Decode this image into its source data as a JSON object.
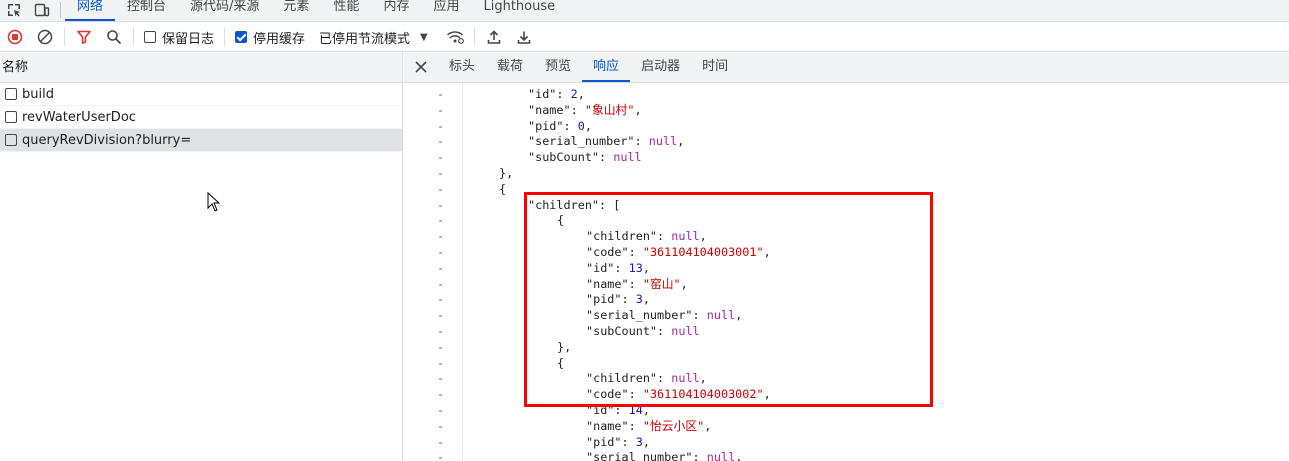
{
  "devtools_tabs": [
    "网络",
    "控制台",
    "源代码/来源",
    "元素",
    "性能",
    "内存",
    "应用",
    "Lighthouse"
  ],
  "active_tab_index": 0,
  "toolbar": {
    "preserve_log": "保留日志",
    "disable_cache": "停用缓存",
    "throttle": "已停用节流模式"
  },
  "left": {
    "header": "名称",
    "requests": [
      "build",
      "revWaterUserDoc",
      "queryRevDivision?blurry="
    ],
    "selected_index": 2
  },
  "detail_tabs": [
    "标头",
    "载荷",
    "预览",
    "响应",
    "启动器",
    "时间"
  ],
  "active_detail_index": 3,
  "code_lines": [
    {
      "indent": 0,
      "parts": [
        [
          "k",
          "\"id\""
        ],
        [
          "p",
          ": "
        ],
        [
          "n",
          "2"
        ],
        [
          "p",
          ","
        ]
      ]
    },
    {
      "indent": 0,
      "parts": [
        [
          "k",
          "\"name\""
        ],
        [
          "p",
          ": "
        ],
        [
          "s",
          "\"象山村\""
        ],
        [
          "p",
          ","
        ]
      ]
    },
    {
      "indent": 0,
      "parts": [
        [
          "k",
          "\"pid\""
        ],
        [
          "p",
          ": "
        ],
        [
          "n",
          "0"
        ],
        [
          "p",
          ","
        ]
      ]
    },
    {
      "indent": 0,
      "parts": [
        [
          "k",
          "\"serial_number\""
        ],
        [
          "p",
          ": "
        ],
        [
          "w",
          "null"
        ],
        [
          "p",
          ","
        ]
      ]
    },
    {
      "indent": 0,
      "parts": [
        [
          "k",
          "\"subCount\""
        ],
        [
          "p",
          ": "
        ],
        [
          "w",
          "null"
        ]
      ]
    },
    {
      "indent": -1,
      "parts": [
        [
          "p",
          "},"
        ]
      ]
    },
    {
      "indent": -1,
      "parts": [
        [
          "p",
          "{"
        ]
      ]
    },
    {
      "indent": 0,
      "parts": [
        [
          "k",
          "\"children\""
        ],
        [
          "p",
          ": ["
        ]
      ]
    },
    {
      "indent": 1,
      "parts": [
        [
          "p",
          "{"
        ]
      ]
    },
    {
      "indent": 2,
      "parts": [
        [
          "k",
          "\"children\""
        ],
        [
          "p",
          ": "
        ],
        [
          "w",
          "null"
        ],
        [
          "p",
          ","
        ]
      ]
    },
    {
      "indent": 2,
      "parts": [
        [
          "k",
          "\"code\""
        ],
        [
          "p",
          ": "
        ],
        [
          "s",
          "\"361104104003001\""
        ],
        [
          "p",
          ","
        ]
      ]
    },
    {
      "indent": 2,
      "parts": [
        [
          "k",
          "\"id\""
        ],
        [
          "p",
          ": "
        ],
        [
          "n",
          "13"
        ],
        [
          "p",
          ","
        ]
      ]
    },
    {
      "indent": 2,
      "parts": [
        [
          "k",
          "\"name\""
        ],
        [
          "p",
          ": "
        ],
        [
          "s",
          "\"窑山\""
        ],
        [
          "p",
          ","
        ]
      ]
    },
    {
      "indent": 2,
      "parts": [
        [
          "k",
          "\"pid\""
        ],
        [
          "p",
          ": "
        ],
        [
          "n",
          "3"
        ],
        [
          "p",
          ","
        ]
      ]
    },
    {
      "indent": 2,
      "parts": [
        [
          "k",
          "\"serial_number\""
        ],
        [
          "p",
          ": "
        ],
        [
          "w",
          "null"
        ],
        [
          "p",
          ","
        ]
      ]
    },
    {
      "indent": 2,
      "parts": [
        [
          "k",
          "\"subCount\""
        ],
        [
          "p",
          ": "
        ],
        [
          "w",
          "null"
        ]
      ]
    },
    {
      "indent": 1,
      "parts": [
        [
          "p",
          "},"
        ]
      ]
    },
    {
      "indent": 1,
      "parts": [
        [
          "p",
          "{"
        ]
      ]
    },
    {
      "indent": 2,
      "parts": [
        [
          "k",
          "\"children\""
        ],
        [
          "p",
          ": "
        ],
        [
          "w",
          "null"
        ],
        [
          "p",
          ","
        ]
      ]
    },
    {
      "indent": 2,
      "parts": [
        [
          "k",
          "\"code\""
        ],
        [
          "p",
          ": "
        ],
        [
          "s",
          "\"361104104003002\""
        ],
        [
          "p",
          ","
        ]
      ]
    },
    {
      "indent": 2,
      "parts": [
        [
          "k",
          "\"id\""
        ],
        [
          "p",
          ": "
        ],
        [
          "n",
          "14"
        ],
        [
          "p",
          ","
        ]
      ]
    },
    {
      "indent": 2,
      "parts": [
        [
          "k",
          "\"name\""
        ],
        [
          "p",
          ": "
        ],
        [
          "s",
          "\"怡云小区\""
        ],
        [
          "p",
          ","
        ]
      ]
    },
    {
      "indent": 2,
      "parts": [
        [
          "k",
          "\"pid\""
        ],
        [
          "p",
          ": "
        ],
        [
          "n",
          "3"
        ],
        [
          "p",
          ","
        ]
      ]
    },
    {
      "indent": 2,
      "parts": [
        [
          "k",
          "\"serial_number\""
        ],
        [
          "p",
          ": "
        ],
        [
          "w",
          "null"
        ],
        [
          "p",
          ","
        ]
      ]
    }
  ],
  "gutter_marker": "-"
}
